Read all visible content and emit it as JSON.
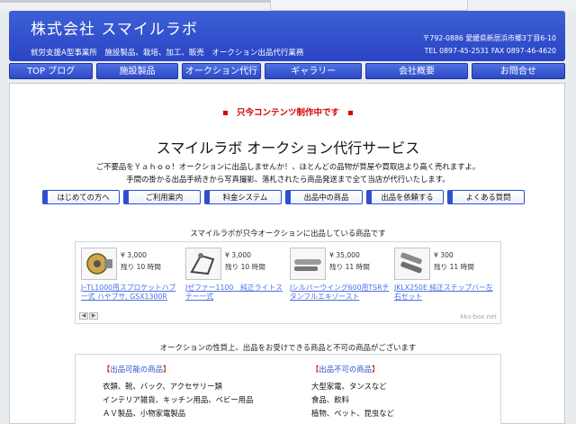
{
  "header": {
    "company": "株式会社 スマイルラボ",
    "tagline": "就労支援A型事業所　施設製品、栽培、加工、販売　オークション出品代行業務",
    "address": "〒792-0886 愛媛県新居浜市郷3丁目6-10",
    "phone": "TEL 0897-45-2531 FAX 0897-46-4620"
  },
  "nav": [
    "TOP ブログ",
    "施設製品",
    "オークション代行",
    "ギャラリー",
    "会社概要",
    "お問合せ"
  ],
  "notice": "只今コンテンツ制作中です",
  "page_title": "スマイルラボ オークション代行サービス",
  "description": [
    "ご不要品をＹａｈｏｏ！オークションに出品しませんか！、ほとんどの品物が質屋や買取店より高く売れますよ。",
    "手間の掛かる出品手続きから写真撮影、落札されたら商品発送まで全て当店が代行いたします。"
  ],
  "tabs": [
    "はじめての方へ",
    "ご利用案内",
    "料金システム",
    "出品中の商品",
    "出品を依頼する",
    "よくある質問"
  ],
  "listing_title": "スマイルラボが只今オークションに出品している商品です",
  "items": [
    {
      "price": "¥ 3,000",
      "remain": "残り 10 時間",
      "name": "JｰTL1000用スプロケットハブ一式 ハヤブサ, GSX1300R"
    },
    {
      "price": "¥ 3,000",
      "remain": "残り 10 時間",
      "name": "Jゼファー1100　純正ライトステー一式"
    },
    {
      "price": "¥ 35,000",
      "remain": "残り 11 時間",
      "name": "Jシルバーウイング600用TSRチタンフルエキゾースト"
    },
    {
      "price": "¥ 300",
      "remain": "残り 11 時間",
      "name": "JKLX250E 純正ステップバー左右セット"
    }
  ],
  "widget": {
    "credit": "kks-box.net",
    "prev": "◀",
    "next": "▶"
  },
  "conditions_title": "オークションの性質上、出品をお受けできる商品と不可の商品がございます",
  "ok_list": {
    "open": "【",
    "title": "出品可能の商品",
    "close": "】",
    "items": [
      "衣類、靴、バック、アクセサリー類",
      "インテリア雑貨、キッチン用品、ベビー用品",
      "ＡＶ製品、小物家電製品"
    ]
  },
  "ng_list": {
    "open": "【",
    "title": "出品不可の商品",
    "close": "】",
    "items": [
      "大型家電、タンスなど",
      "食品、飲料",
      "植物、ペット、昆虫など"
    ]
  }
}
